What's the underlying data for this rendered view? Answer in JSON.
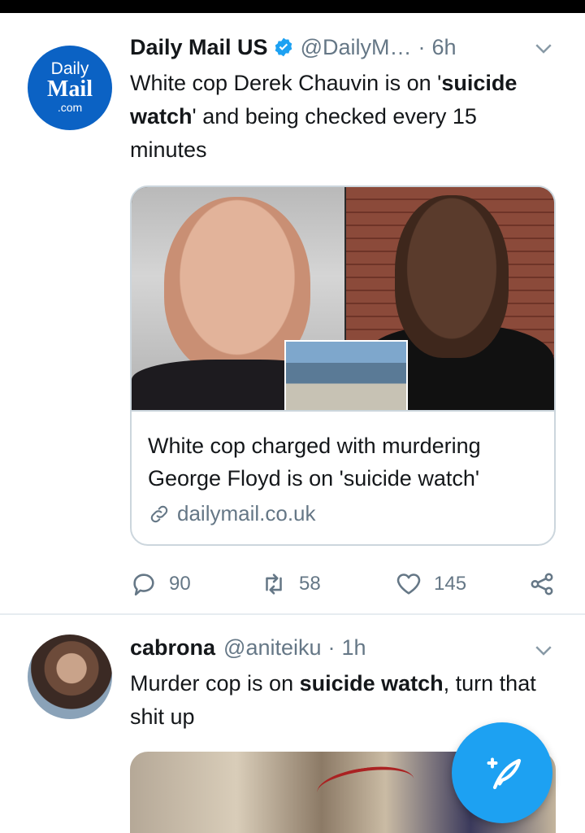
{
  "tweet1": {
    "avatar_text": [
      "Daily",
      "Mail",
      ".com"
    ],
    "name": "Daily Mail US",
    "handle": "@DailyM…",
    "dot": "·",
    "time": "6h",
    "text_parts": [
      "White cop Derek Chauvin is on '",
      "suicide watch",
      "' and being checked every 15 minutes"
    ],
    "card": {
      "title": "White cop charged with murdering George Floyd is on 'suicide watch'",
      "domain": "dailymail.co.uk"
    },
    "actions": {
      "replies": "90",
      "retweets": "58",
      "likes": "145"
    }
  },
  "tweet2": {
    "name": "cabrona",
    "handle": "@aniteiku",
    "dot": "·",
    "time": "1h",
    "text_parts": [
      "Murder cop is on ",
      "suicide watch",
      ", turn that shit up"
    ]
  },
  "colors": {
    "accent": "#1da1f2",
    "secondary_text": "#657786",
    "brand_dailymail": "#0b62c4"
  },
  "icons": {
    "verified": "verified-badge-icon",
    "chevron": "chevron-down-icon",
    "reply": "reply-icon",
    "retweet": "retweet-icon",
    "like": "heart-icon",
    "share": "share-icon",
    "link": "link-icon",
    "compose": "compose-tweet-icon"
  }
}
